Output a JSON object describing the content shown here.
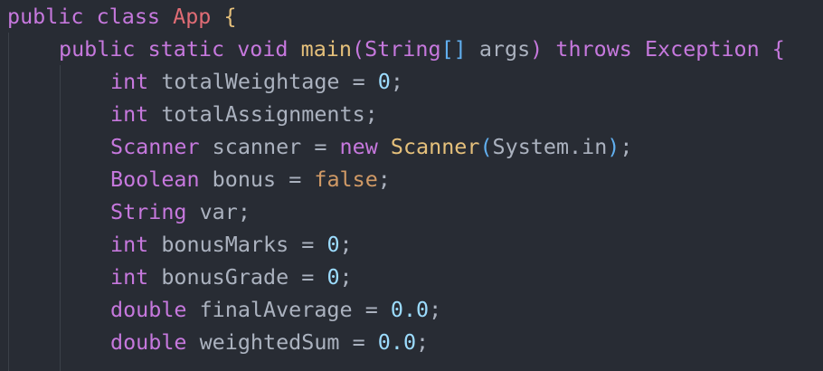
{
  "lines": [
    {
      "tokens": [
        "public",
        "class",
        "App",
        "{"
      ]
    },
    {
      "tokens": [
        "public",
        "static",
        "void",
        "main",
        "(",
        "String",
        "[]",
        "args",
        ")",
        "throws",
        "Exception",
        "{"
      ]
    },
    {
      "tokens": [
        "int",
        "totalWeightage",
        "=",
        "0",
        ";"
      ]
    },
    {
      "tokens": [
        "int",
        "totalAssignments",
        ";"
      ]
    },
    {
      "tokens": [
        "Scanner",
        "scanner",
        "=",
        "new",
        "Scanner",
        "(",
        "System.in",
        ")",
        ";"
      ]
    },
    {
      "tokens": [
        "Boolean",
        "bonus",
        "=",
        "false",
        ";"
      ]
    },
    {
      "tokens": [
        "String",
        "var",
        ";"
      ]
    },
    {
      "tokens": [
        "int",
        "bonusMarks",
        "=",
        "0",
        ";"
      ]
    },
    {
      "tokens": [
        "int",
        "bonusGrade",
        "=",
        "0",
        ";"
      ]
    },
    {
      "tokens": [
        "double",
        "finalAverage",
        "=",
        "0.0",
        ";"
      ]
    },
    {
      "tokens": [
        "double",
        "weightedSum",
        "=",
        "0.0",
        ";"
      ]
    }
  ],
  "colors": {
    "background": "#282c34",
    "keyword": "#c678dd",
    "class_name": "#e06c75",
    "function": "#e5c07b",
    "number": "#9cdcfe",
    "boolean_literal": "#d19a66",
    "plain": "#abb2bf"
  }
}
